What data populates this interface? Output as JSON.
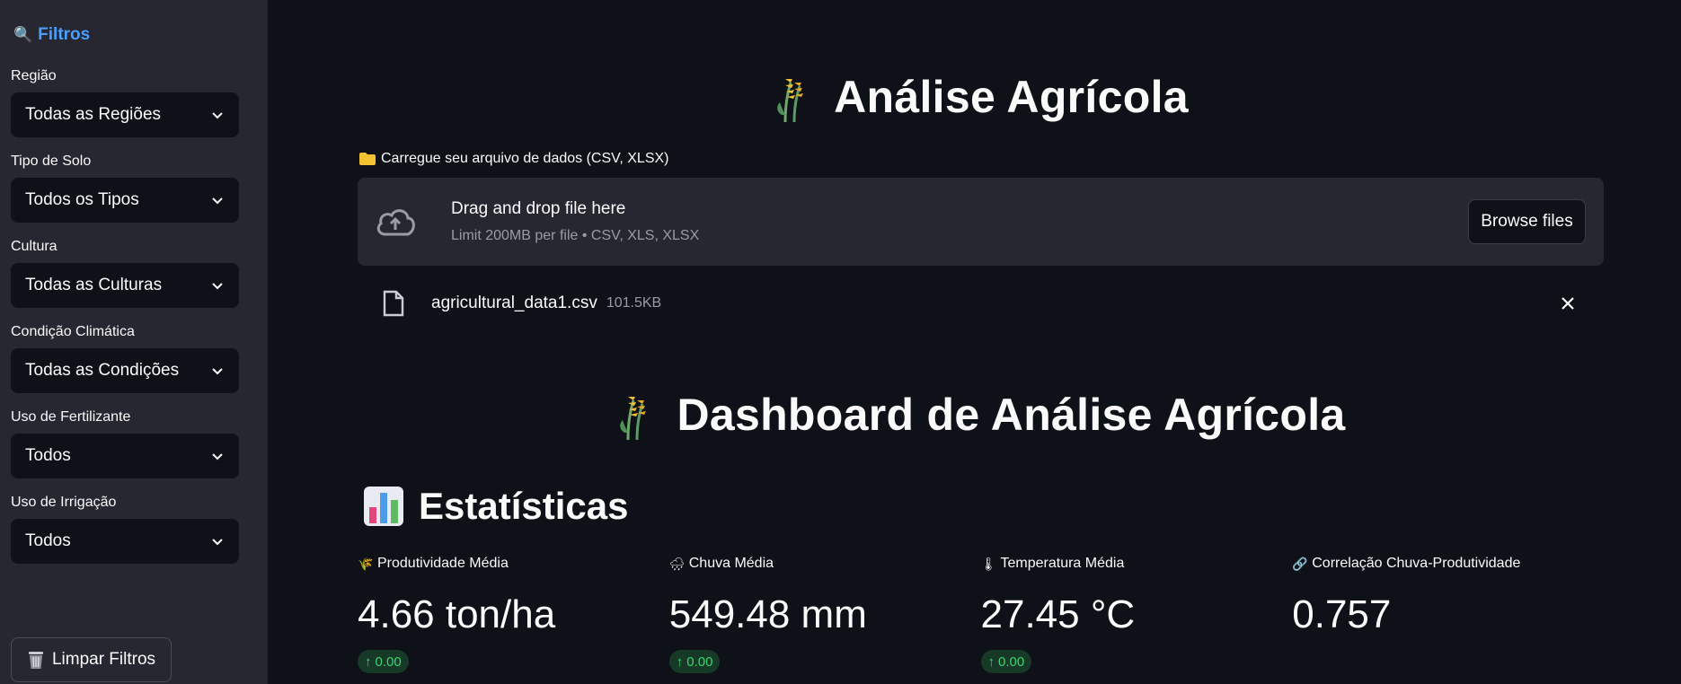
{
  "sidebar": {
    "title": "Filtros",
    "filters": [
      {
        "label": "Região",
        "value": "Todas as Regiões"
      },
      {
        "label": "Tipo de Solo",
        "value": "Todos os Tipos"
      },
      {
        "label": "Cultura",
        "value": "Todas as Culturas"
      },
      {
        "label": "Condição Climática",
        "value": "Todas as Condições"
      },
      {
        "label": "Uso de Fertilizante",
        "value": "Todos"
      },
      {
        "label": "Uso de Irrigação",
        "value": "Todos"
      }
    ],
    "clear_button": "Limpar Filtros"
  },
  "main": {
    "title": "Análise Agrícola",
    "uploader": {
      "label": "Carregue seu arquivo de dados (CSV, XLSX)",
      "drop_title": "Drag and drop file here",
      "drop_sub": "Limit 200MB per file • CSV, XLS, XLSX",
      "browse": "Browse files"
    },
    "file": {
      "name": "agricultural_data1.csv",
      "size": "101.5KB"
    },
    "dashboard_title": "Dashboard de Análise Agrícola",
    "stats_title": "Estatísticas",
    "metrics": [
      {
        "icon": "🌾",
        "label": "Produtividade Média",
        "value": "4.66 ton/ha",
        "delta": "0.00"
      },
      {
        "icon": "🌧",
        "label": "Chuva Média",
        "value": "549.48 mm",
        "delta": "0.00"
      },
      {
        "icon": "🌡",
        "label": "Temperatura Média",
        "value": "27.45 °C",
        "delta": "0.00"
      },
      {
        "icon": "🔗",
        "label": "Correlação Chuva-Produtividade",
        "value": "0.757",
        "delta": ""
      }
    ]
  },
  "colors": {
    "accent": "#4a9eff",
    "delta_bg": "#173928",
    "delta_fg": "#3dd56d"
  }
}
